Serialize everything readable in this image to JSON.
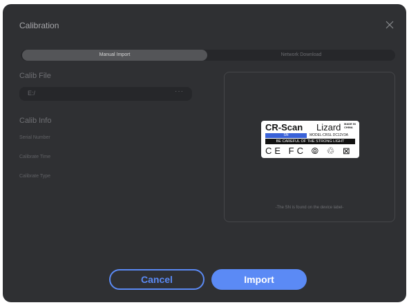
{
  "dialog": {
    "title": "Calibration",
    "close_icon": "close-icon"
  },
  "tabs": [
    {
      "label": "Manual Import",
      "active": true
    },
    {
      "label": "Network Download",
      "active": false
    }
  ],
  "calib_file": {
    "label": "Calib File",
    "value": "E:/",
    "browse_label": "···"
  },
  "calib_info": {
    "label": "Calib Info",
    "fields": [
      {
        "label": "Serial Number"
      },
      {
        "label": "Calibrate Time"
      },
      {
        "label": "Calibrate Type"
      }
    ]
  },
  "device_label": {
    "brand_bold": "CR-Scan",
    "brand_light": "Lizard",
    "made_in": "MADE IN CHINA",
    "sn": "SN",
    "model": "MODEL:CRSL  DC12V3A",
    "warning": "BE CAREFUL OF THE STRONG LIGHT",
    "certs": "CE FC ⦾ ♲ ⊠"
  },
  "hint": "-The SN is found on the device label-",
  "buttons": {
    "cancel": "Cancel",
    "import": "Import"
  },
  "colors": {
    "dialog_bg": "#2f3033",
    "accent": "#5b8af5"
  }
}
